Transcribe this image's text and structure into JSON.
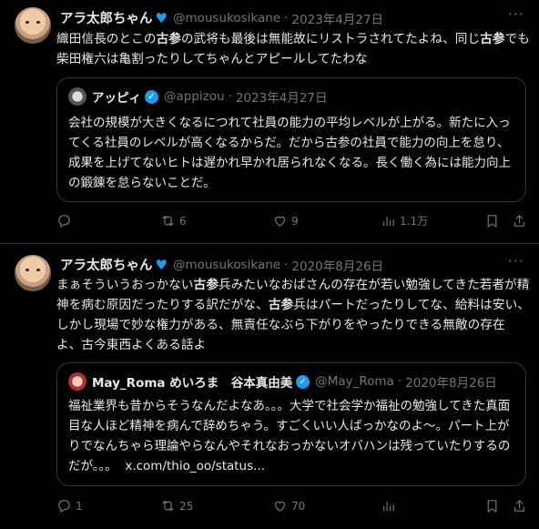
{
  "tweets": [
    {
      "name": "アラ太郎ちゃん",
      "handle": "@mousukosikane",
      "date": "2023年4月27日",
      "more": "···",
      "text_parts": [
        "織田信長のとこの",
        "古参",
        "の武将も最後は無能故にリストラされてたよね、同じ",
        "古参",
        "でも柴田権六は亀割ったりしてちゃんとアピールしてたわな"
      ],
      "quote": {
        "name": "アッピィ",
        "handle": "@appizou",
        "date": "2023年4月27日",
        "text": "会社の規模が大きくなるにつれて社員の能力の平均レベルが上がる。新たに入ってくる社員のレベルが高くなるからだ。だから古参の社員で能力の向上を怠り、成果を上げてないヒトは遅かれ早かれ居られなくなる。長く働く為には能力向上の鍛錬を怠らないことだ。"
      },
      "stats": {
        "replies": "",
        "retweets": "6",
        "likes": "9",
        "views": "1.1万"
      }
    },
    {
      "name": "アラ太郎ちゃん",
      "handle": "@mousukosikane",
      "date": "2020年8月26日",
      "more": "···",
      "text_parts": [
        "まぁそういうおっかない",
        "古参",
        "兵みたいなおばさんの存在が若い勉強してきた若者が精神を病む原因だったりする訳だがな、",
        "古参",
        "兵はパートだったりしてな、給料は安い、しかし現場で妙な権力がある、無責任なぶら下がりをやったりできる無敵の存在よ、古今東西よくある話よ"
      ],
      "quote": {
        "name": "May_Roma めいろま　谷本真由美",
        "handle": "@May_Roma",
        "date": "2020年8月26日",
        "text": "福祉業界も昔からそうなんだよなあ。。。大学で社会学か福祉の勉強してきた真面目な人ほど精神を病んで辞めちゃう。すごくいい人ばっかなのよ〜。パート上がりでなんちゃら理論やらなんやそれなおっかないオバハンは残っていたりするのだが。。。",
        "link": "x.com/thio_oo/status..."
      },
      "stats": {
        "replies": "1",
        "retweets": "25",
        "likes": "70",
        "views": ""
      }
    }
  ],
  "dot": "·",
  "icons": [
    "reply-icon",
    "retweet-icon",
    "like-icon",
    "views-icon",
    "bookmark-icon",
    "share-icon",
    "verified-icon"
  ],
  "colors": {
    "background": "#000000",
    "text": "#e7e9ea",
    "muted": "#71767b",
    "border": "#2f3336",
    "accent": "#1d9bf0"
  }
}
